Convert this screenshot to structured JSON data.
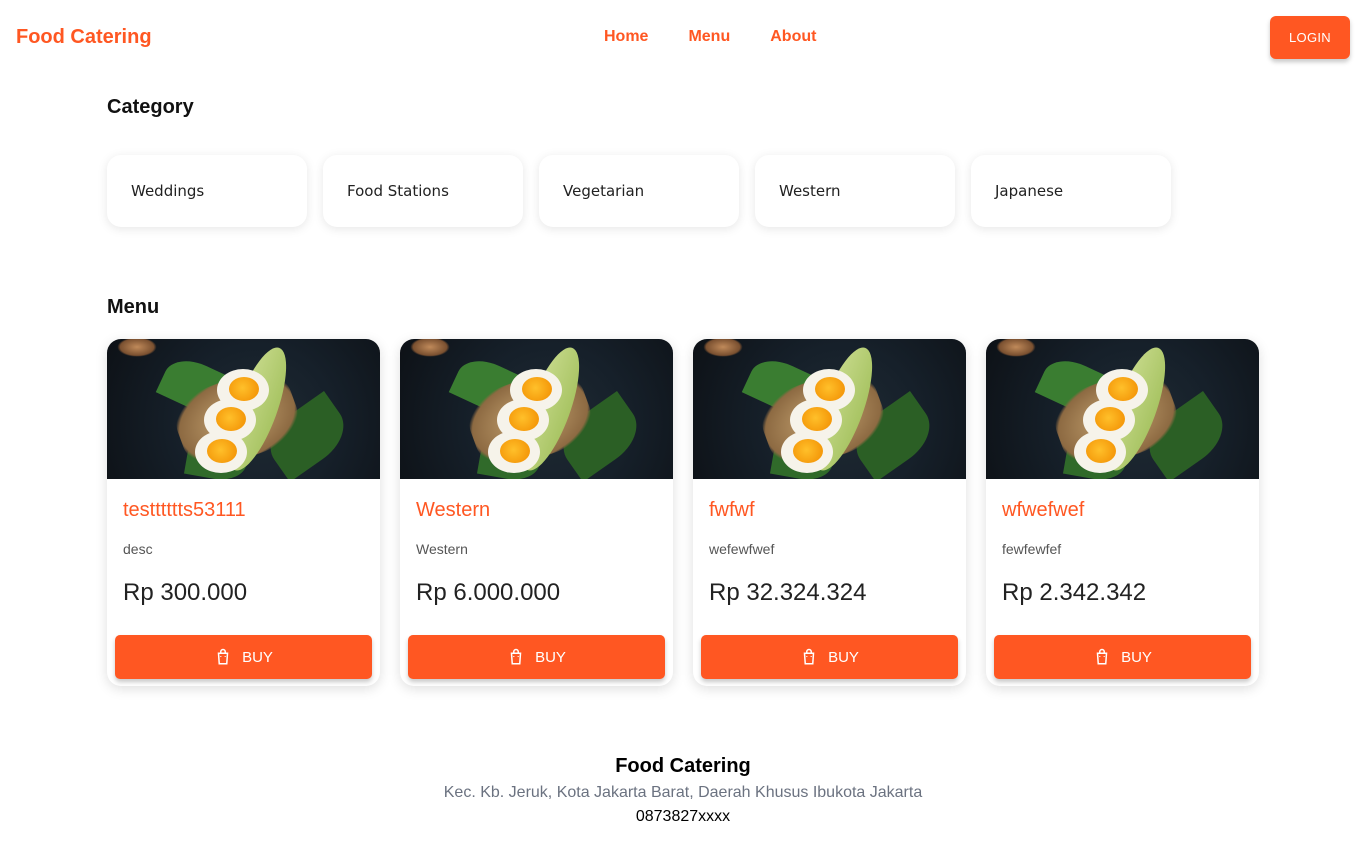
{
  "header": {
    "brand": "Food Catering",
    "nav": [
      "Home",
      "Menu",
      "About"
    ],
    "login_label": "LOGIN"
  },
  "category": {
    "title": "Category",
    "items": [
      "Weddings",
      "Food Stations",
      "Vegetarian",
      "Western",
      "Japanese"
    ]
  },
  "menu": {
    "title": "Menu",
    "items": [
      {
        "name": "testttttts53111",
        "desc": "desc",
        "price": "Rp 300.000",
        "buy_label": "BUY"
      },
      {
        "name": "Western",
        "desc": "Western",
        "price": "Rp 6.000.000",
        "buy_label": "BUY"
      },
      {
        "name": "fwfwf",
        "desc": "wefewfwef",
        "price": "Rp 32.324.324",
        "buy_label": "BUY"
      },
      {
        "name": "wfwefwef",
        "desc": "fewfewfef",
        "price": "Rp 2.342.342",
        "buy_label": "BUY"
      }
    ]
  },
  "footer": {
    "name": "Food Catering",
    "address": "Kec. Kb. Jeruk, Kota Jakarta Barat, Daerah Khusus Ibukota Jakarta",
    "phone": "0873827xxxx"
  },
  "colors": {
    "accent": "#ff5722",
    "muted": "#6b7280"
  },
  "icons": {
    "buy": "shopping-bag-icon"
  }
}
